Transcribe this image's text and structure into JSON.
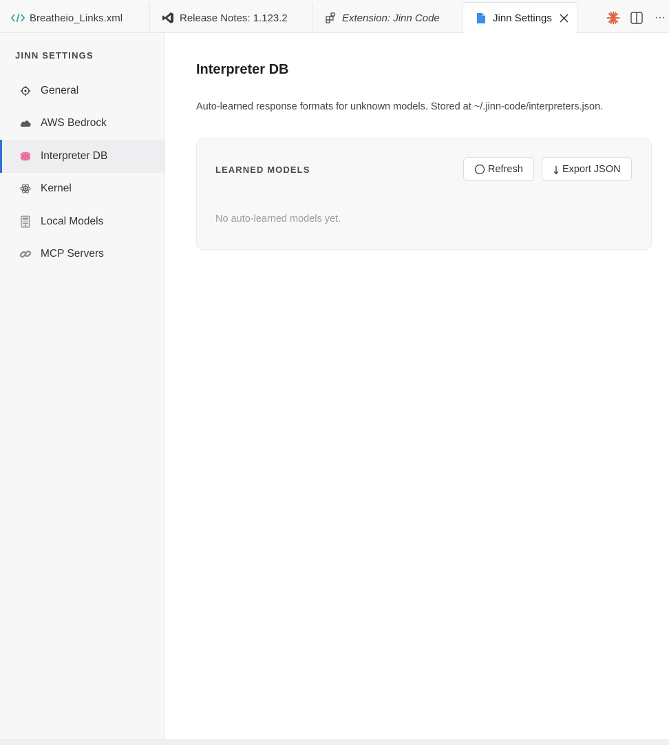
{
  "tabs": [
    {
      "label": "Breatheio_Links.xml",
      "icon": "code-brackets-icon",
      "italic": false,
      "active": false
    },
    {
      "label": "Release Notes: 1.123.2",
      "icon": "vscode-logo-icon",
      "italic": false,
      "active": false
    },
    {
      "label": "Extension: Jinn Code",
      "icon": "extensions-icon",
      "italic": true,
      "active": false
    },
    {
      "label": "Jinn Settings",
      "icon": "file-icon",
      "italic": false,
      "active": true
    }
  ],
  "tab_actions": {
    "more_label": "···"
  },
  "sidebar": {
    "title": "JINN SETTINGS",
    "items": [
      {
        "label": "General",
        "icon": "gear-icon",
        "active": false
      },
      {
        "label": "AWS Bedrock",
        "icon": "cloud-icon",
        "active": false
      },
      {
        "label": "Interpreter DB",
        "icon": "brain-icon",
        "active": true
      },
      {
        "label": "Kernel",
        "icon": "atom-icon",
        "active": false
      },
      {
        "label": "Local Models",
        "icon": "device-icon",
        "active": false
      },
      {
        "label": "MCP Servers",
        "icon": "link-icon",
        "active": false
      }
    ]
  },
  "main": {
    "title": "Interpreter DB",
    "description": "Auto-learned response formats for unknown models. Stored at ~/.jinn-code/interpreters.json.",
    "card": {
      "title": "LEARNED MODELS",
      "refresh_label": "Refresh",
      "export_label": "Export JSON",
      "empty_text": "No auto-learned models yet."
    }
  },
  "colors": {
    "accent": "#2f6fd6",
    "active_tab_icon": "#3b8eea",
    "brand_spark": "#d9663f"
  }
}
